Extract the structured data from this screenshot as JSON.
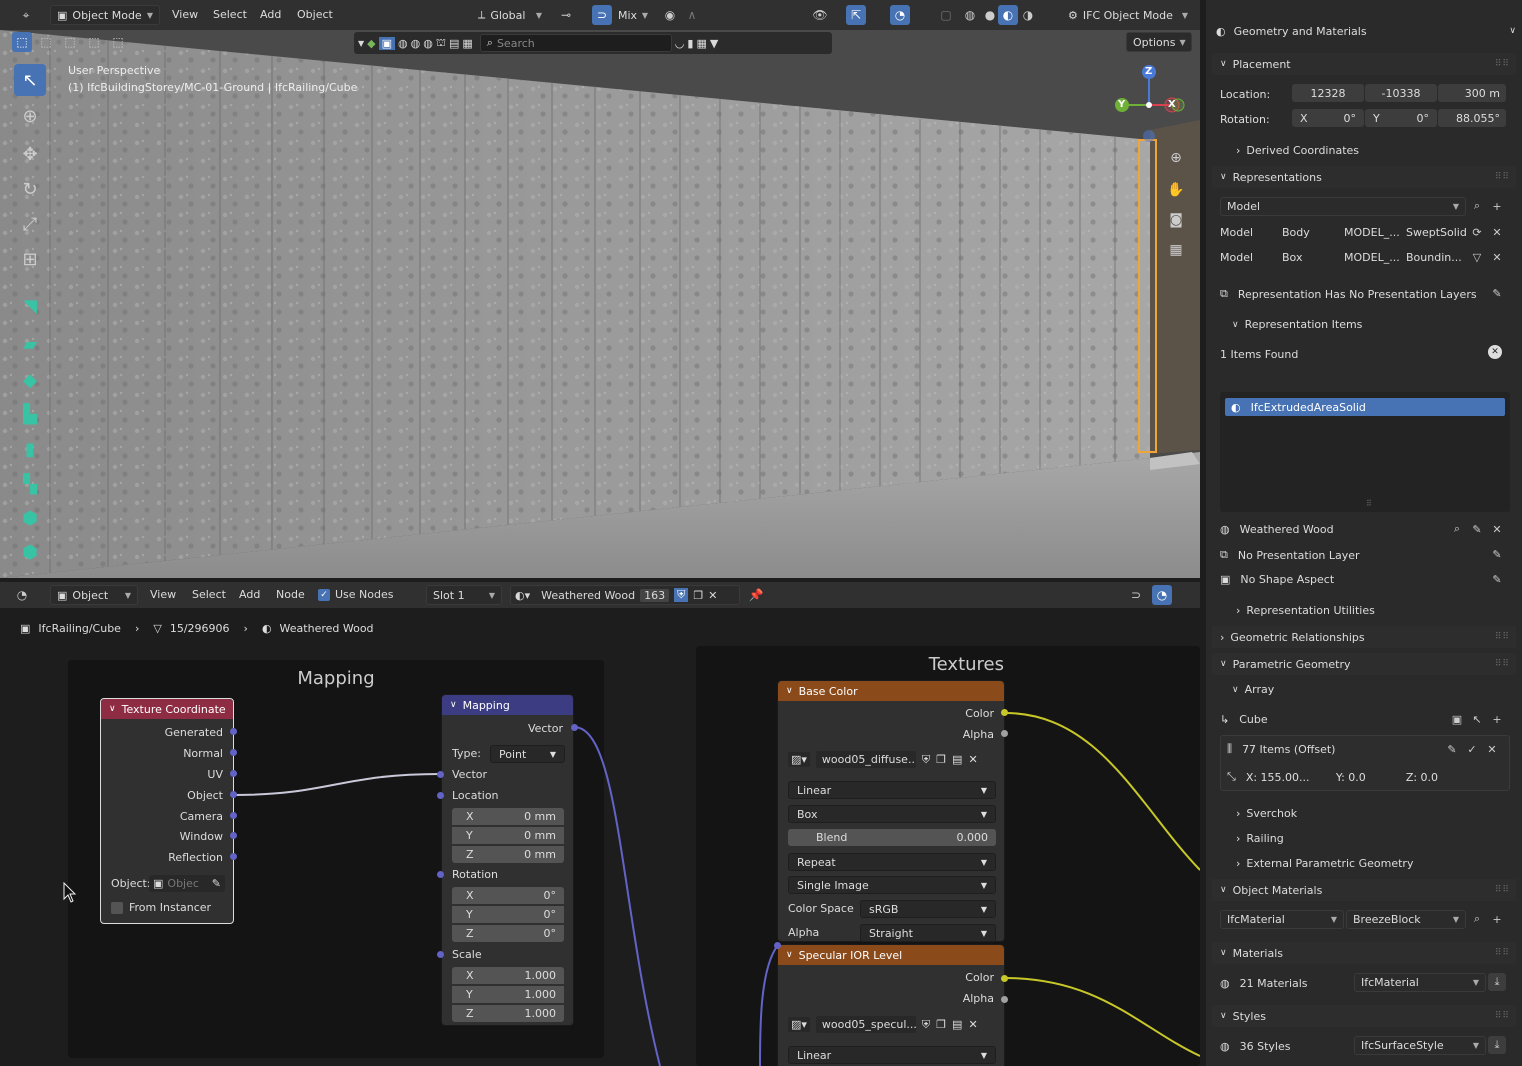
{
  "colors": {
    "accent": "#4772b3",
    "selected_outline": "#f0a53a",
    "node_texcoord": "#8d2c43",
    "node_mapping": "#3c3c83",
    "node_image": "#8a4a1a",
    "socket_vector": "#6363c7",
    "socket_color": "#c7c729",
    "socket_float": "#a1a1a1"
  },
  "viewport": {
    "mode": "Object Mode",
    "menus": [
      "View",
      "Select",
      "Add",
      "Object"
    ],
    "orientation": "Global",
    "pivot": "Mix",
    "ifc_mode": "IFC Object Mode",
    "search_placeholder": "Search",
    "options_label": "Options",
    "info_line1": "User Perspective",
    "info_line2": "(1) IfcBuildingStorey/MC-01-Ground | IfcRailing/Cube",
    "gizmo": {
      "z": "Z",
      "y": "Y",
      "x": "X"
    }
  },
  "node_header": {
    "editor": "Object",
    "menus": [
      "View",
      "Select",
      "Add",
      "Node"
    ],
    "use_nodes_label": "Use Nodes",
    "slot": "Slot 1",
    "material": "Weathered Wood",
    "users": "163"
  },
  "breadcrumb": {
    "object": "IfcRailing/Cube",
    "mesh": "15/296906",
    "material": "Weathered Wood"
  },
  "frames": {
    "mapping": "Mapping",
    "textures": "Textures"
  },
  "texcoord": {
    "title": "Texture Coordinate",
    "outputs": [
      "Generated",
      "Normal",
      "UV",
      "Object",
      "Camera",
      "Window",
      "Reflection"
    ],
    "object_label": "Object:",
    "object_placeholder": "Objec",
    "from_instancer": "From Instancer"
  },
  "mapping": {
    "title": "Mapping",
    "out_vector": "Vector",
    "type_label": "Type:",
    "type_value": "Point",
    "in_vector": "Vector",
    "location": "Location",
    "loc": [
      {
        "a": "X",
        "v": "0 mm"
      },
      {
        "a": "Y",
        "v": "0 mm"
      },
      {
        "a": "Z",
        "v": "0 mm"
      }
    ],
    "rotation": "Rotation",
    "rot": [
      {
        "a": "X",
        "v": "0°"
      },
      {
        "a": "Y",
        "v": "0°"
      },
      {
        "a": "Z",
        "v": "0°"
      }
    ],
    "scale": "Scale",
    "scl": [
      {
        "a": "X",
        "v": "1.000"
      },
      {
        "a": "Y",
        "v": "1.000"
      },
      {
        "a": "Z",
        "v": "1.000"
      }
    ],
    "cut_label": "Vector"
  },
  "basecolor": {
    "title": "Base Color",
    "out_color": "Color",
    "out_alpha": "Alpha",
    "image": "wood05_diffuse...",
    "interp": "Linear",
    "proj": "Box",
    "blend_label": "Blend",
    "blend_value": "0.000",
    "ext": "Repeat",
    "source": "Single Image",
    "cs_label": "Color Space",
    "cs_value": "sRGB",
    "alpha_label": "Alpha",
    "alpha_value": "Straight"
  },
  "specular": {
    "title": "Specular IOR Level",
    "out_color": "Color",
    "out_alpha": "Alpha",
    "image": "wood05_specul...",
    "interp": "Linear"
  },
  "panel": {
    "top": "Geometry and Materials",
    "placement": "Placement",
    "location_label": "Location:",
    "loc": [
      "12328",
      "-10338",
      "300 m"
    ],
    "rotation_label": "Rotation:",
    "rot": [
      {
        "a": "X",
        "v": "0°"
      },
      {
        "a": "Y",
        "v": "0°"
      },
      {
        "v": "88.055°"
      }
    ],
    "derived": "Derived Coordinates",
    "representations": "Representations",
    "context": "Model",
    "reps": [
      {
        "a": "Model",
        "b": "Body",
        "c": "MODEL_...",
        "d": "SweptSolid"
      },
      {
        "a": "Model",
        "b": "Box",
        "c": "MODEL_...",
        "d": "Boundin..."
      }
    ],
    "no_layers": "Representation Has No Presentation Layers",
    "rep_items": "Representation Items",
    "found": "1 Items Found",
    "item": "IfcExtrudedAreaSolid",
    "style": "Weathered Wood",
    "no_pres": "No Presentation Layer",
    "no_shape": "No Shape Aspect",
    "rep_util": "Representation Utilities",
    "geo_rel": "Geometric Relationships",
    "param": "Parametric Geometry",
    "array": "Array",
    "cube": "Cube",
    "items_offset": "77 Items (Offset)",
    "offx": "X: 155.00...",
    "offy": "Y: 0.0",
    "offz": "Z: 0.0",
    "sverchok": "Sverchok",
    "railing": "Railing",
    "ext_param": "External Parametric Geometry",
    "obj_mat": "Object Materials",
    "mat_type": "IfcMaterial",
    "mat_name": "BreezeBlock",
    "materials": "Materials",
    "mat_count": "21 Materials",
    "mat_class": "IfcMaterial",
    "styles": "Styles",
    "style_count": "36 Styles",
    "style_class": "IfcSurfaceStyle"
  }
}
